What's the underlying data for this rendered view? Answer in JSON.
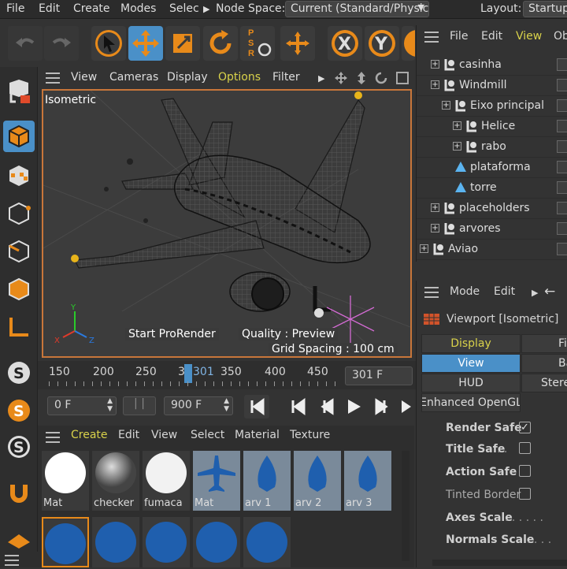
{
  "menubar": {
    "items": [
      "File",
      "Edit",
      "Create",
      "Modes",
      "Select"
    ],
    "node_space_label": "Node Space:",
    "node_space_value": "Current (Standard/Physical)",
    "layout_label": "Layout:",
    "layout_value": "Startup"
  },
  "toolbar": {
    "icons": [
      "undo-icon",
      "redo-icon",
      "live-selection-icon",
      "move-icon",
      "scale-icon",
      "rotate-icon",
      "coordinate-system-icon",
      "world-axis-icon",
      "x-axis-lock",
      "y-axis-lock",
      "z-axis-lock"
    ],
    "axis_labels": [
      "X",
      "Y"
    ],
    "psr_label": "PSR"
  },
  "viewport": {
    "menu": [
      "View",
      "Cameras",
      "Display",
      "Options",
      "Filter"
    ],
    "camera_name": "Isometric",
    "start_prorender": "Start ProRender",
    "quality": "Quality : Preview",
    "grid_spacing": "Grid Spacing : 100 cm",
    "axis": {
      "x": "X",
      "y": "Y",
      "z": "Z"
    }
  },
  "timeline": {
    "ticks": [
      "150",
      "200",
      "250",
      "3",
      "301",
      "350",
      "400",
      "450"
    ],
    "current_frame": "301 F"
  },
  "transport": {
    "start_frame": "0 F",
    "end_frame": "900 F"
  },
  "material_manager": {
    "menu": [
      "Create",
      "Edit",
      "View",
      "Select",
      "Material",
      "Texture"
    ],
    "materials": [
      {
        "name": "Mat",
        "type": "white-sphere"
      },
      {
        "name": "checker",
        "type": "checker-sphere"
      },
      {
        "name": "fumaca",
        "type": "white-sphere"
      },
      {
        "name": "Mat",
        "type": "blue-plane-icon"
      },
      {
        "name": "arv 1",
        "type": "blue-tree"
      },
      {
        "name": "arv 2",
        "type": "blue-tree"
      },
      {
        "name": "arv 3",
        "type": "blue-tree"
      }
    ]
  },
  "object_manager": {
    "menu": [
      "File",
      "Edit",
      "View",
      "Ob"
    ],
    "objects": [
      {
        "name": "casinha",
        "indent": 1,
        "expander": true,
        "icon": "null-icon"
      },
      {
        "name": "Windmill",
        "indent": 1,
        "expander": true,
        "icon": "null-icon"
      },
      {
        "name": "Eixo principal",
        "indent": 2,
        "expander": true,
        "icon": "null-icon"
      },
      {
        "name": "Helice",
        "indent": 3,
        "expander": true,
        "icon": "null-icon"
      },
      {
        "name": "rabo",
        "indent": 3,
        "expander": true,
        "icon": "null-icon"
      },
      {
        "name": "plataforma",
        "indent": 2,
        "expander": false,
        "icon": "cone-icon"
      },
      {
        "name": "torre",
        "indent": 2,
        "expander": false,
        "icon": "cone-icon"
      },
      {
        "name": "placeholders",
        "indent": 1,
        "expander": true,
        "icon": "null-icon"
      },
      {
        "name": "arvores",
        "indent": 1,
        "expander": true,
        "icon": "null-icon"
      },
      {
        "name": "Aviao",
        "indent": 0,
        "expander": true,
        "icon": "null-icon"
      }
    ]
  },
  "attribute_manager": {
    "menu": [
      "Mode",
      "Edit"
    ],
    "title": "Viewport [Isometric]",
    "tabs_row1": [
      "Display",
      "Fi"
    ],
    "tabs_row2": [
      "View",
      "Ba"
    ],
    "tabs_row3": [
      "HUD",
      "Stereo"
    ],
    "tab_row4": "Enhanced OpenGL",
    "properties": [
      {
        "label": "Render Safe",
        "checked": true
      },
      {
        "label": "Title Safe",
        "checked": false
      },
      {
        "label": "Action Safe",
        "checked": false
      },
      {
        "label": "Tinted Border",
        "checked": false
      },
      {
        "label": "Axes Scale",
        "checked": false
      },
      {
        "label": "Normals Scale",
        "checked": false
      }
    ]
  },
  "colors": {
    "accent": "#4a90c8",
    "orange": "#e88a1a",
    "highlight_text": "#d9d24a"
  }
}
